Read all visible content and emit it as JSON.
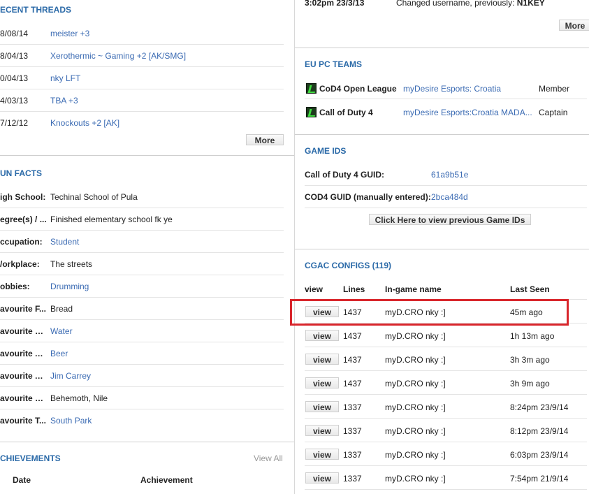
{
  "recent_threads": {
    "title": "ECENT THREADS",
    "rows": [
      {
        "date": "8/08/14",
        "title": "meister +3"
      },
      {
        "date": "8/04/13",
        "title": "Xerothermic ~ Gaming +2 [AK/SMG]"
      },
      {
        "date": "0/04/13",
        "title": "nky LFT"
      },
      {
        "date": "4/03/13",
        "title": "TBA +3"
      },
      {
        "date": "7/12/12",
        "title": "Knockouts +2 [AK]"
      }
    ],
    "more_label": "More"
  },
  "fun_facts": {
    "title": "UN FACTS",
    "rows": [
      {
        "label": "igh School:",
        "value": "Techinal School of Pula",
        "linked": false
      },
      {
        "label": "egree(s) / ...",
        "value": "Finished elementary school fk ye",
        "linked": false
      },
      {
        "label": "ccupation:",
        "value": "Student",
        "linked": true
      },
      {
        "label": "/orkplace:",
        "value": "The streets",
        "linked": false
      },
      {
        "label": "obbies:",
        "value": "Drumming",
        "linked": true
      },
      {
        "label": "avourite F...",
        "value": "Bread",
        "linked": false
      },
      {
        "label": "avourite D...",
        "value": "Water",
        "linked": true
      },
      {
        "label": "avourite Al...",
        "value": "Beer",
        "linked": true
      },
      {
        "label": "avourite A...",
        "value": "Jim Carrey",
        "linked": true
      },
      {
        "label": "avourite B...",
        "value": "Behemoth, Nile",
        "linked": false
      },
      {
        "label": "avourite T...",
        "value": "South Park",
        "linked": true
      }
    ]
  },
  "achievements": {
    "title": "CHIEVEMENTS",
    "view_all": "View All",
    "col_date": "Date",
    "col_achievement": "Achievement"
  },
  "history": {
    "time": "3:02pm 23/3/13",
    "text": "Changed username, previously:",
    "name": "N1KEY",
    "more_label": "More"
  },
  "eu_pc_teams": {
    "title": "EU PC TEAMS",
    "rows": [
      {
        "game": "CoD4 Open League",
        "team": "myDesire Esports: Croatia",
        "role": "Member"
      },
      {
        "game": "Call of Duty 4",
        "team": "myDesire Esports:Croatia MADA...",
        "role": "Captain"
      }
    ]
  },
  "game_ids": {
    "title": "GAME IDS",
    "rows": [
      {
        "label": "Call of Duty 4 GUID:",
        "value": "61a9b51e"
      },
      {
        "label": "COD4 GUID (manually entered):",
        "value": "2bca484d"
      }
    ],
    "prev_button": "Click Here to view previous Game IDs"
  },
  "cgac_configs": {
    "title": "CGAC CONFIGS (119)",
    "headers": {
      "view": "view",
      "lines": "Lines",
      "name": "In-game name",
      "seen": "Last Seen"
    },
    "view_label": "view",
    "rows": [
      {
        "lines": "1437",
        "name": "myD.CRO nky :]",
        "seen": "45m ago"
      },
      {
        "lines": "1437",
        "name": "myD.CRO nky :]",
        "seen": "1h 13m ago"
      },
      {
        "lines": "1437",
        "name": "myD.CRO nky :]",
        "seen": "3h 3m ago"
      },
      {
        "lines": "1437",
        "name": "myD.CRO nky :]",
        "seen": "3h 9m ago"
      },
      {
        "lines": "1337",
        "name": "myD.CRO nky :]",
        "seen": "8:24pm 23/9/14"
      },
      {
        "lines": "1337",
        "name": "myD.CRO nky :]",
        "seen": "8:12pm 23/9/14"
      },
      {
        "lines": "1337",
        "name": "myD.CRO nky :]",
        "seen": "6:03pm 23/9/14"
      },
      {
        "lines": "1337",
        "name": "myD.CRO nky :]",
        "seen": "7:54pm 21/9/14"
      }
    ]
  }
}
